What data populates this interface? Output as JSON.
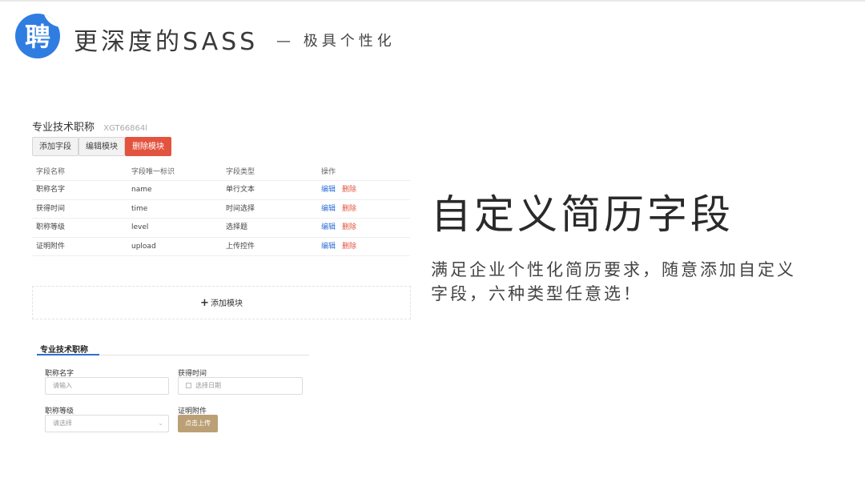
{
  "brand": {
    "logo_glyph": "聘",
    "title": "更深度的SASS",
    "subtitle": "— 极具个性化",
    "accent": "#2f7de1"
  },
  "module": {
    "title": "专业技术职称",
    "code": "XGT66864l",
    "buttons": {
      "add_field": "添加字段",
      "edit_module": "编辑模块",
      "delete_module": "删除模块"
    },
    "columns": [
      "字段名称",
      "字段唯一标识",
      "字段类型",
      "操作"
    ],
    "rows": [
      {
        "name": "职称名字",
        "key": "name",
        "type": "单行文本"
      },
      {
        "name": "获得时间",
        "key": "time",
        "type": "时间选择"
      },
      {
        "name": "职称等级",
        "key": "level",
        "type": "选择题"
      },
      {
        "name": "证明附件",
        "key": "upload",
        "type": "上传控件"
      }
    ],
    "action_edit": "编辑",
    "action_delete": "删除",
    "add_module": "添加模块",
    "danger_color": "#e2543f"
  },
  "form_preview": {
    "tab": "专业技术职称",
    "field1_label": "职称名字",
    "field1_placeholder": "请输入",
    "field2_label": "获得时间",
    "field2_placeholder": "选择日期",
    "field3_label": "职称等级",
    "field3_placeholder": "请选择",
    "field4_label": "证明附件",
    "upload_label": "点击上传",
    "upload_color": "#bba076"
  },
  "feature": {
    "headline": "自定义简历字段",
    "description": "满足企业个性化简历要求，随意添加自定义字段，六种类型任意选！"
  }
}
